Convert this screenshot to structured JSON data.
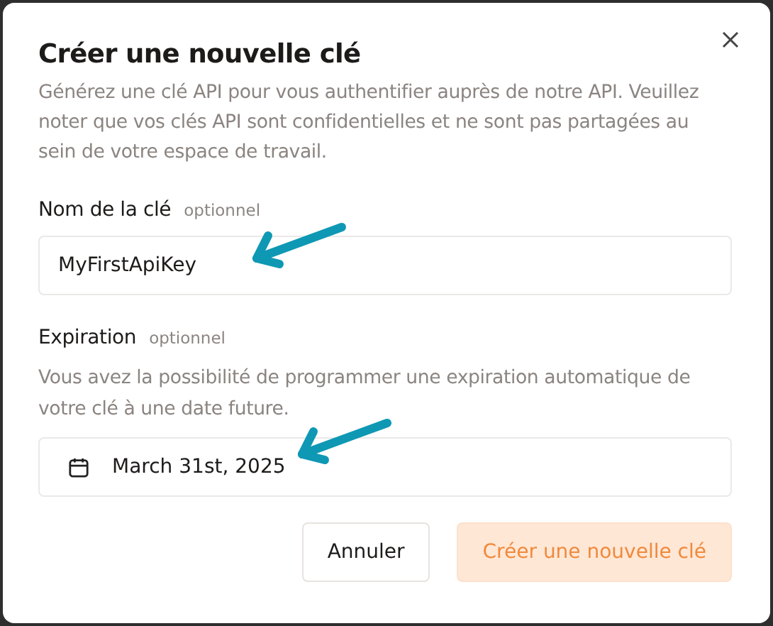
{
  "dialog": {
    "title": "Créer une nouvelle clé",
    "description": "Générez une clé API pour vous authentifier auprès de notre API. Veuillez noter que vos clés API sont confidentielles et ne sont pas partagées au sein de votre espace de travail."
  },
  "fields": [
    {
      "kind": "text",
      "label": "Nom de la clé",
      "hint": "optionnel",
      "value": "MyFirstApiKey"
    },
    {
      "kind": "date",
      "label": "Expiration",
      "hint": "optionnel",
      "help": "Vous avez la possibilité de programmer une expiration automatique de votre clé à une date future.",
      "value": "March 31st, 2025"
    }
  ],
  "buttons": [
    {
      "kind": "secondary",
      "label": "Annuler"
    },
    {
      "kind": "primary",
      "label": "Créer une nouvelle clé"
    }
  ]
}
